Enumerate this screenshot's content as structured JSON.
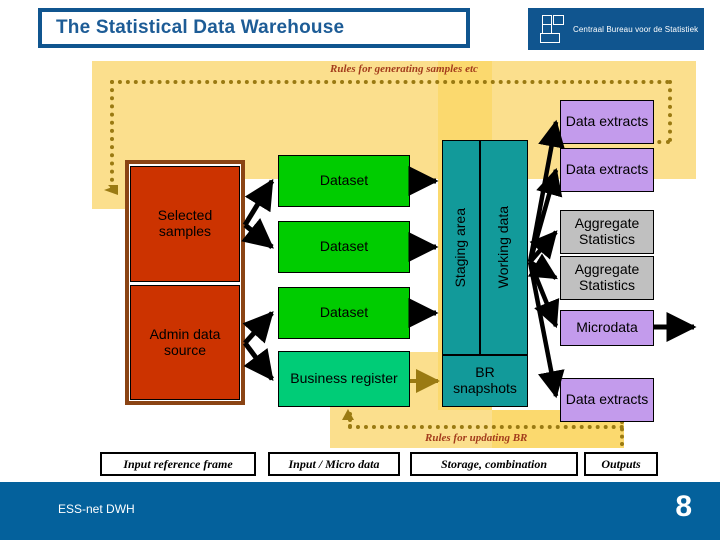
{
  "header": {
    "title": "The Statistical Data Warehouse",
    "logo_text": "Centraal Bureau voor de Statistiek",
    "logo_mark": "cbs-logo-icon"
  },
  "diagram": {
    "rules": {
      "top_caption": "Rules for generating samples etc",
      "bottom_caption": "Rules for updating BR"
    },
    "input_frame": {
      "selected_samples": "Selected samples",
      "admin_data_source": "Admin data source"
    },
    "inputs": [
      {
        "label": "Dataset",
        "color": "#00cc00"
      },
      {
        "label": "Dataset",
        "color": "#00cc00"
      },
      {
        "label": "Dataset",
        "color": "#00cc00"
      },
      {
        "label": "Business register",
        "color": "#00cc77"
      }
    ],
    "storage": {
      "staging_area": "Staging area",
      "working_data": "Working data",
      "br_snapshots": "BR snapshots",
      "color": "#129a9a"
    },
    "outputs": [
      {
        "label": "Data extracts",
        "color": "#c39bec"
      },
      {
        "label": "Data extracts",
        "color": "#c39bec"
      },
      {
        "label": "Aggregate Statistics",
        "color": "#c0c0c0"
      },
      {
        "label": "Aggregate Statistics",
        "color": "#c0c0c0"
      },
      {
        "label": "Microdata",
        "color": "#c39bec"
      },
      {
        "label": "Data extracts",
        "color": "#c39bec"
      }
    ]
  },
  "legend": [
    "Input reference frame",
    "Input / Micro data",
    "Storage, combination",
    "Outputs"
  ],
  "footer": {
    "project": "ESS-net DWH",
    "page_number": "8"
  },
  "colors": {
    "brand_blue": "#10558f",
    "footer_blue": "#04619c",
    "rule_band": "#fbdf8d",
    "rule_text": "#a33c1c",
    "dotted_line": "#9a7a12",
    "frame_brown": "#8a4414",
    "source_red": "#cc3300"
  }
}
